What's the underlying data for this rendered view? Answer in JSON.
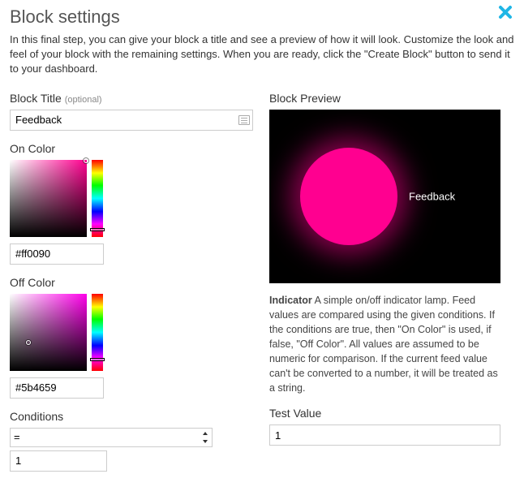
{
  "header": {
    "title": "Block settings",
    "intro": "In this final step, you can give your block a title and see a preview of how it will look. Customize the look and feel of your block with the remaining settings. When you are ready, click the \"Create Block\" button to send it to your dashboard."
  },
  "left": {
    "title_label": "Block Title ",
    "title_optional": "(optional)",
    "title_value": "Feedback",
    "on_color_label": "On Color",
    "on_color_hex": "#ff0090",
    "on_color_base": "#ff0090",
    "off_color_label": "Off Color",
    "off_color_hex": "#5b4659",
    "off_color_base": "#ff00ea",
    "conditions_label": "Conditions",
    "conditions_op": "=",
    "conditions_value": "1"
  },
  "right": {
    "preview_label": "Block Preview",
    "lamp_label": "Feedback",
    "desc_title": "Indicator",
    "desc_body": " A simple on/off indicator lamp. Feed values are compared using the given conditions. If the conditions are true, then \"On Color\" is used, if false, \"Off Color\". All values are assumed to be numeric for comparison. If the current feed value can't be converted to a number, it will be treated as a string.",
    "test_label": "Test Value",
    "test_value": "1"
  }
}
